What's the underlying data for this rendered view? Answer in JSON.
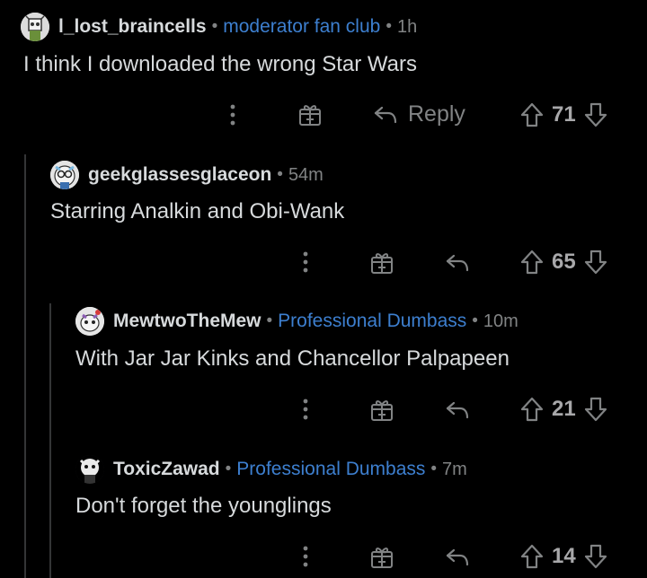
{
  "comments": [
    {
      "username": "l_lost_braincells",
      "flair": "moderator fan club",
      "time": "1h",
      "text": "I think I downloaded the wrong Star Wars",
      "reply_label": "Reply",
      "score": "71"
    },
    {
      "username": "geekglassesglaceon",
      "flair": "",
      "time": "54m",
      "text": "Starring Analkin and Obi-Wank",
      "score": "65"
    },
    {
      "username": "MewtwoTheMew",
      "flair": "Professional Dumbass",
      "time": "10m",
      "text": "With Jar Jar Kinks and Chancellor Palpapeen",
      "score": "21"
    },
    {
      "username": "ToxicZawad",
      "flair": "Professional Dumbass",
      "time": "7m",
      "text": "Don't forget the younglings",
      "score": "14"
    }
  ],
  "separator": "•",
  "icons": [
    "more-options-icon",
    "award-icon",
    "reply-arrow-icon",
    "upvote-icon",
    "downvote-icon"
  ],
  "colors": {
    "background": "#000000",
    "text": "#d7dadc",
    "muted": "#818384",
    "flair": "#3d7fcf"
  }
}
